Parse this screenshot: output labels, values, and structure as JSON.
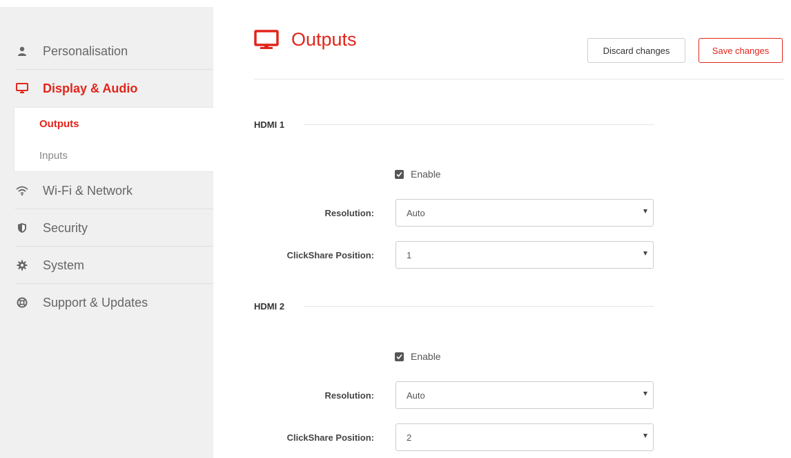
{
  "sidebar": {
    "items": [
      {
        "label": "Personalisation",
        "icon": "user-icon"
      },
      {
        "label": "Display & Audio",
        "icon": "monitor-icon",
        "active": true,
        "subitems": [
          {
            "label": "Outputs",
            "active": true
          },
          {
            "label": "Inputs"
          }
        ]
      },
      {
        "label": "Wi-Fi & Network",
        "icon": "wifi-icon"
      },
      {
        "label": "Security",
        "icon": "shield-icon"
      },
      {
        "label": "System",
        "icon": "gear-icon"
      },
      {
        "label": "Support & Updates",
        "icon": "lifebuoy-icon"
      }
    ]
  },
  "header": {
    "title": "Outputs",
    "icon": "monitor-icon",
    "discard_label": "Discard changes",
    "save_label": "Save changes"
  },
  "sections": [
    {
      "title": "HDMI 1",
      "enable_label": "Enable",
      "enabled": true,
      "resolution_label": "Resolution:",
      "resolution_value": "Auto",
      "position_label": "ClickShare Position:",
      "position_value": "1"
    },
    {
      "title": "HDMI 2",
      "enable_label": "Enable",
      "enabled": true,
      "resolution_label": "Resolution:",
      "resolution_value": "Auto",
      "position_label": "ClickShare Position:",
      "position_value": "2"
    }
  ],
  "colors": {
    "accent": "#e1251b",
    "sidebar_bg": "#f0f0f0",
    "text_muted": "#666666"
  }
}
